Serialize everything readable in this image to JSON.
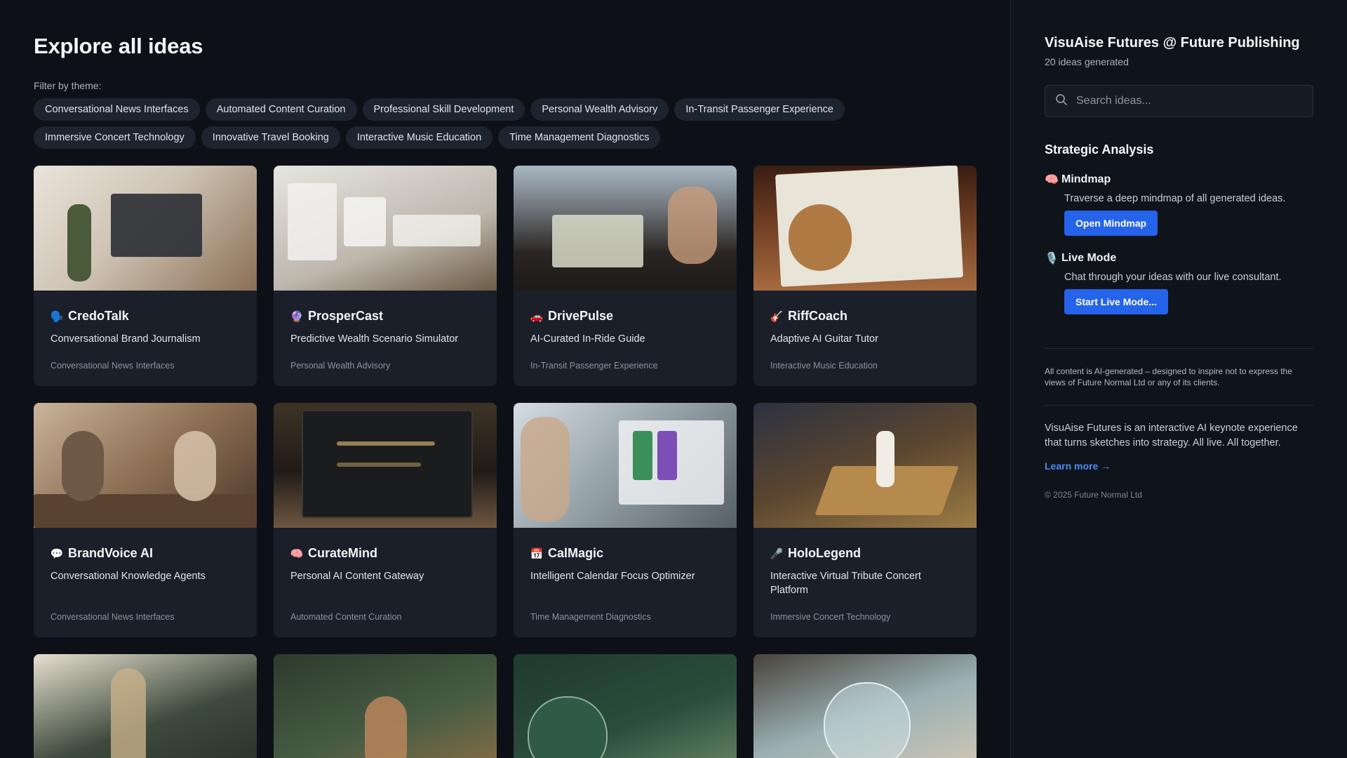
{
  "page": {
    "title": "Explore all ideas",
    "filter_label": "Filter by theme:"
  },
  "filters": [
    "Conversational News Interfaces",
    "Automated Content Curation",
    "Professional Skill Development",
    "Personal Wealth Advisory",
    "In-Transit Passenger Experience",
    "Immersive Concert Technology",
    "Innovative Travel Booking",
    "Interactive Music Education",
    "Time Management Diagnostics"
  ],
  "cards": [
    {
      "emoji": "🗣️",
      "icon_name": "speaking-head-icon",
      "title": "CredoTalk",
      "subtitle": "Conversational Brand Journalism",
      "theme": "Conversational News Interfaces"
    },
    {
      "emoji": "🔮",
      "icon_name": "crystal-ball-icon",
      "title": "ProsperCast",
      "subtitle": "Predictive Wealth Scenario Simulator",
      "theme": "Personal Wealth Advisory"
    },
    {
      "emoji": "🚗",
      "icon_name": "car-icon",
      "title": "DrivePulse",
      "subtitle": "AI-Curated In-Ride Guide",
      "theme": "In-Transit Passenger Experience"
    },
    {
      "emoji": "🎸",
      "icon_name": "guitar-icon",
      "title": "RiffCoach",
      "subtitle": "Adaptive AI Guitar Tutor",
      "theme": "Interactive Music Education"
    },
    {
      "emoji": "💬",
      "icon_name": "speech-bubble-icon",
      "title": "BrandVoice AI",
      "subtitle": "Conversational Knowledge Agents",
      "theme": "Conversational News Interfaces"
    },
    {
      "emoji": "🧠",
      "icon_name": "brain-icon",
      "title": "CurateMind",
      "subtitle": "Personal AI Content Gateway",
      "theme": "Automated Content Curation"
    },
    {
      "emoji": "📅",
      "icon_name": "calendar-icon",
      "title": "CalMagic",
      "subtitle": "Intelligent Calendar Focus Optimizer",
      "theme": "Time Management Diagnostics"
    },
    {
      "emoji": "🎤",
      "icon_name": "microphone-icon",
      "title": "HoloLegend",
      "subtitle": "Interactive Virtual Tribute Concert Platform",
      "theme": "Immersive Concert Technology"
    }
  ],
  "sidebar": {
    "brand": "VisuAise Futures @ Future Publishing",
    "count": "20 ideas generated",
    "search_placeholder": "Search ideas...",
    "section_title": "Strategic Analysis",
    "mindmap": {
      "emoji": "🧠",
      "title": "Mindmap",
      "desc": "Traverse a deep mindmap of all generated ideas.",
      "button": "Open Mindmap"
    },
    "live": {
      "emoji": "🎙️",
      "title": "Live Mode",
      "desc": "Chat through your ideas with our live consultant.",
      "button": "Start Live Mode..."
    },
    "disclaimer": "All content is AI-generated – designed to inspire not to express the views of Future Normal Ltd or any of its clients.",
    "about": "VisuAise Futures is an interactive AI keynote experience that turns sketches into strategy. All live. All together.",
    "learn_more": "Learn more →",
    "copyright": "© 2025 Future Normal Ltd"
  },
  "colors": {
    "background": "#0d1117",
    "card": "#1a1f29",
    "chip": "#1d2430",
    "accent": "#2563eb",
    "link": "#4c8df6"
  }
}
